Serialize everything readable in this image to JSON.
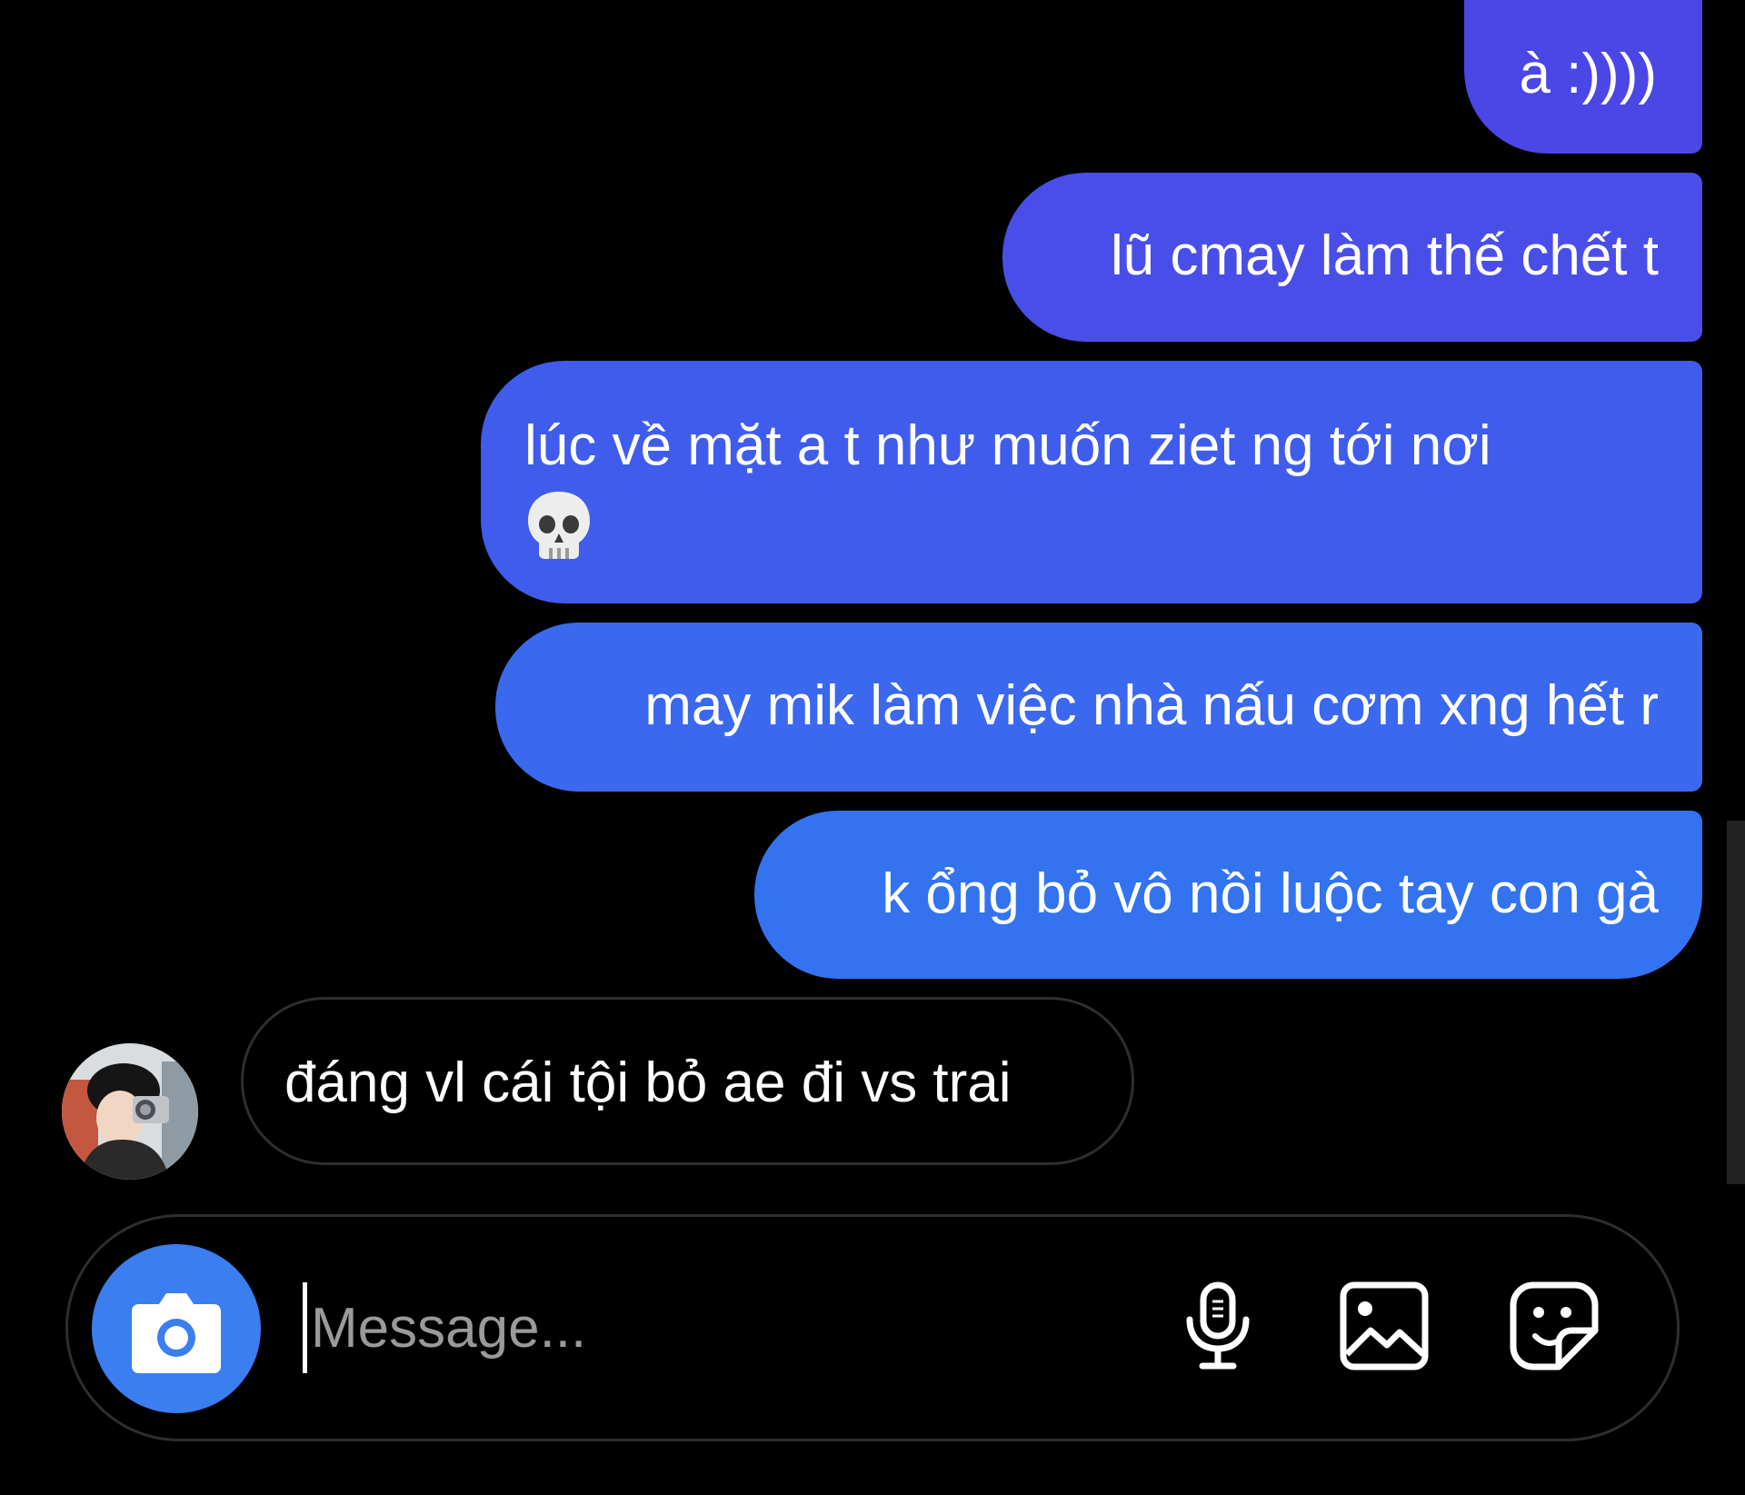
{
  "conversation": {
    "outgoing": [
      {
        "text": "à :))))"
      },
      {
        "text": "lũ cmay làm thế chết t"
      },
      {
        "text": "lúc về mặt a t như muốn ziet ng tới nơi",
        "emoji": "💀"
      },
      {
        "text": "may mik làm việc nhà nấu cơm xng hết r"
      },
      {
        "text": "k ổng bỏ vô nồi luộc tay con gà"
      }
    ],
    "incoming": [
      {
        "text": "đáng vl cái tội bỏ ae đi vs trai"
      }
    ]
  },
  "composer": {
    "placeholder": "Message...",
    "icons": {
      "camera": "camera-icon",
      "mic": "microphone-icon",
      "gallery": "image-icon",
      "sticker": "sticker-icon"
    }
  },
  "colors": {
    "background": "#000000",
    "bubble_out_top": "#4b46e6",
    "bubble_out_bottom": "#3373f0",
    "camera_button": "#3a7ef0",
    "border": "#2e2e2e"
  }
}
